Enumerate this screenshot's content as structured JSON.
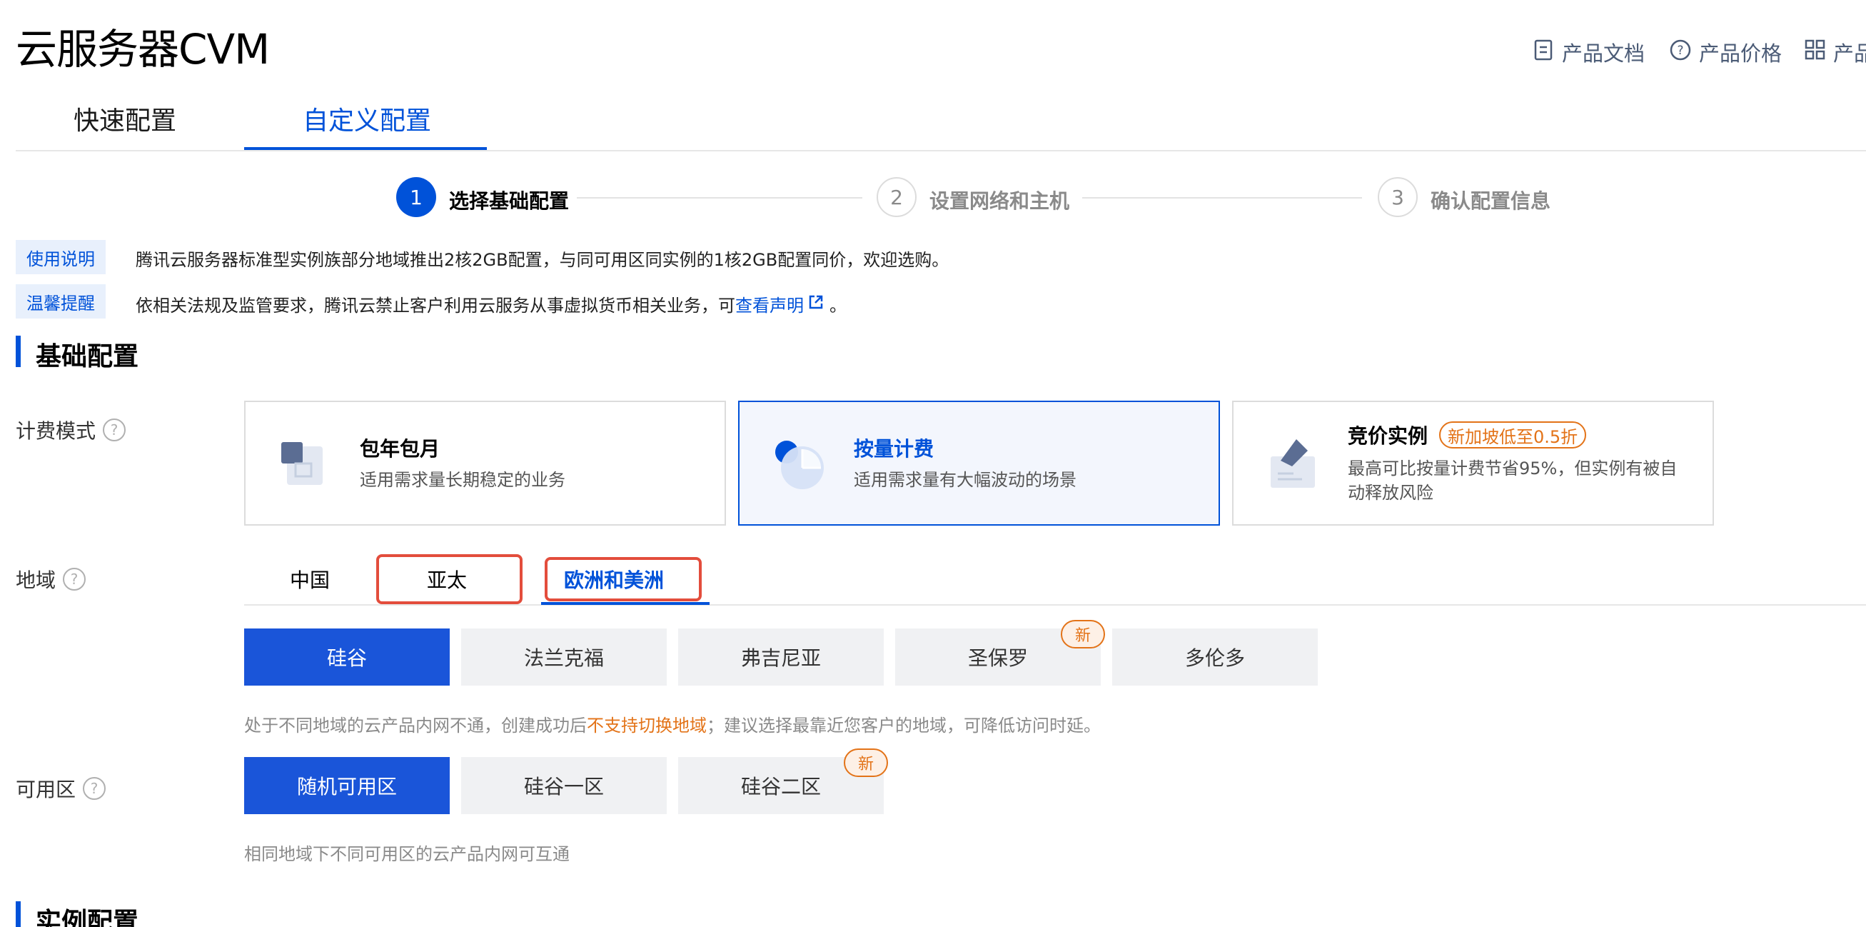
{
  "header": {
    "title": "云服务器CVM",
    "links": [
      {
        "label": "产品文档",
        "icon": "doc-icon"
      },
      {
        "label": "产品价格",
        "icon": "help-circle-icon"
      },
      {
        "label": "产品",
        "icon": "grid-icon"
      }
    ]
  },
  "main_tabs": [
    {
      "label": "快速配置",
      "active": false
    },
    {
      "label": "自定义配置",
      "active": true
    }
  ],
  "steps": [
    {
      "number": "1",
      "label": "选择基础配置",
      "active": true
    },
    {
      "number": "2",
      "label": "设置网络和主机",
      "active": false
    },
    {
      "number": "3",
      "label": "确认配置信息",
      "active": false
    }
  ],
  "notices": [
    {
      "tag": "使用说明",
      "text": "腾讯云服务器标准型实例族部分地域推出2核2GB配置，与同可用区同实例的1核2GB配置同价，欢迎选购。"
    },
    {
      "tag": "温馨提醒",
      "text": "依相关法规及监管要求，腾讯云禁止客户利用云服务从事虚拟货币相关业务，可",
      "link": "查看声明",
      "suffix": "。"
    }
  ],
  "sections": {
    "basic": "基础配置",
    "instance": "实例配置"
  },
  "billing": {
    "label": "计费模式",
    "help_icon": "?",
    "cards": [
      {
        "title": "包年包月",
        "desc": "适用需求量长期稳定的业务",
        "active": false
      },
      {
        "title": "按量计费",
        "desc": "适用需求量有大幅波动的场景",
        "active": true
      },
      {
        "title": "竞价实例",
        "promo": "新加坡低至0.5折",
        "desc_line1": "最高可比按量计费节省95%，但实例有被自",
        "desc_line2": "动释放风险",
        "active": false
      }
    ]
  },
  "region": {
    "label": "地域",
    "tabs": [
      {
        "label": "中国",
        "active": false
      },
      {
        "label": "亚太",
        "active": false
      },
      {
        "label": "欧洲和美洲",
        "active": true
      }
    ],
    "options": [
      {
        "label": "硅谷",
        "active": true
      },
      {
        "label": "法兰克福",
        "active": false
      },
      {
        "label": "弗吉尼亚",
        "active": false
      },
      {
        "label": "圣保罗",
        "active": false,
        "badge": "新"
      },
      {
        "label": "多伦多",
        "active": false
      }
    ],
    "hint_prefix": "处于不同地域的云产品内网不通，创建成功后",
    "hint_warn": "不支持切换地域",
    "hint_suffix": "；建议选择最靠近您客户的地域，可降低访问时延。"
  },
  "zone": {
    "label": "可用区",
    "options": [
      {
        "label": "随机可用区",
        "active": true
      },
      {
        "label": "硅谷一区",
        "active": false
      },
      {
        "label": "硅谷二区",
        "active": false,
        "badge": "新"
      }
    ],
    "hint": "相同地域下不同可用区的云产品内网可互通"
  },
  "colors": {
    "accent": "#0052d9",
    "warning": "#e37318",
    "highlight_box": "#e34d3c"
  }
}
